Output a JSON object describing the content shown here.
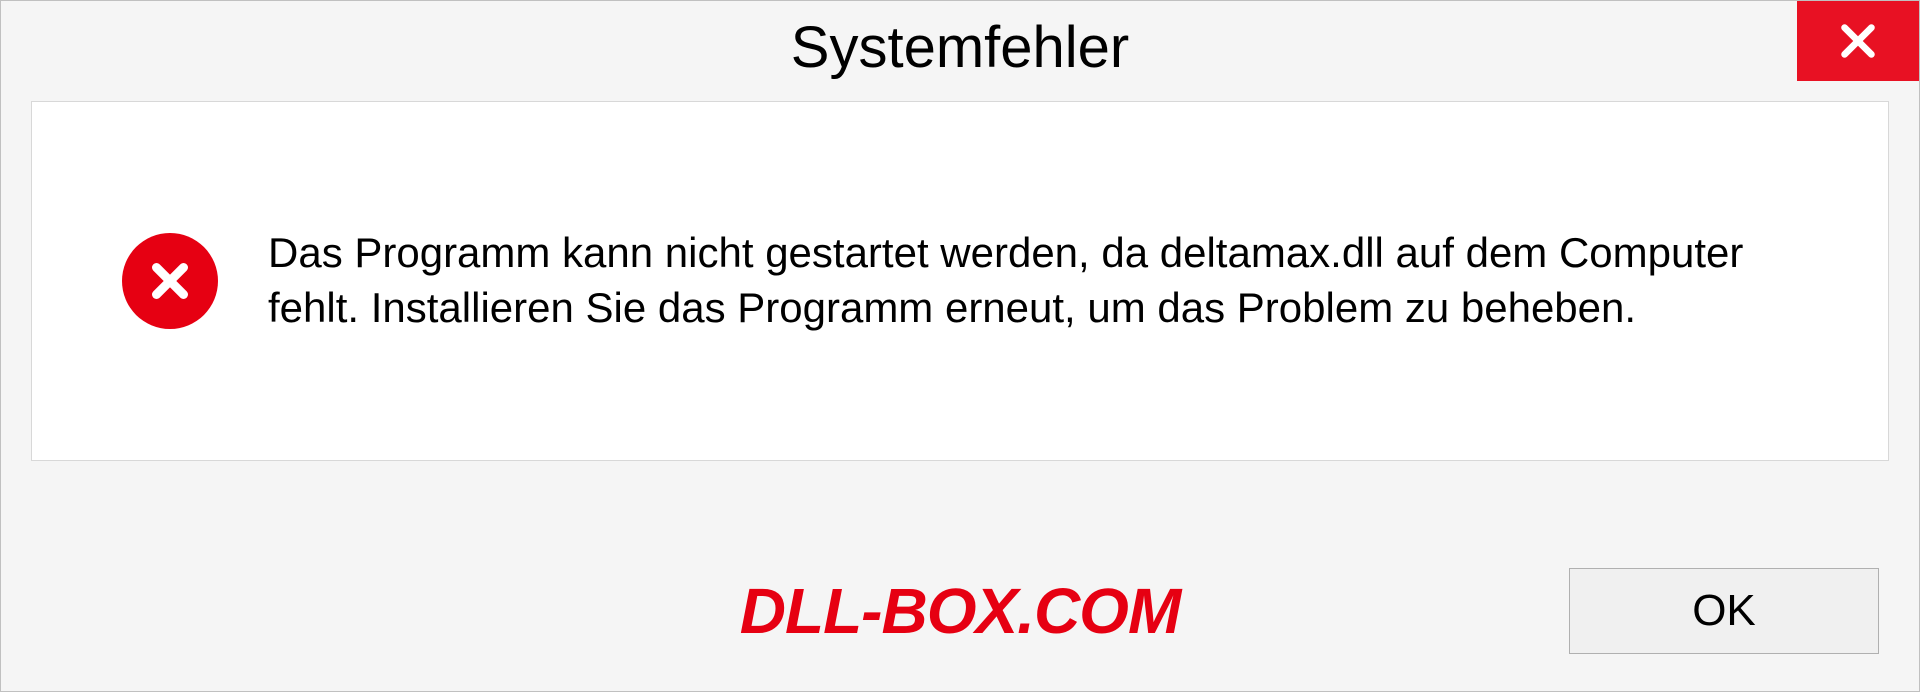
{
  "dialog": {
    "title": "Systemfehler",
    "message": "Das Programm kann nicht gestartet werden, da deltamax.dll auf dem Computer fehlt. Installieren Sie das Programm erneut, um das Problem zu beheben.",
    "ok_label": "OK"
  },
  "watermark": "DLL-BOX.COM",
  "colors": {
    "close_button": "#e81123",
    "error_icon": "#e60012",
    "watermark": "#e60012"
  }
}
